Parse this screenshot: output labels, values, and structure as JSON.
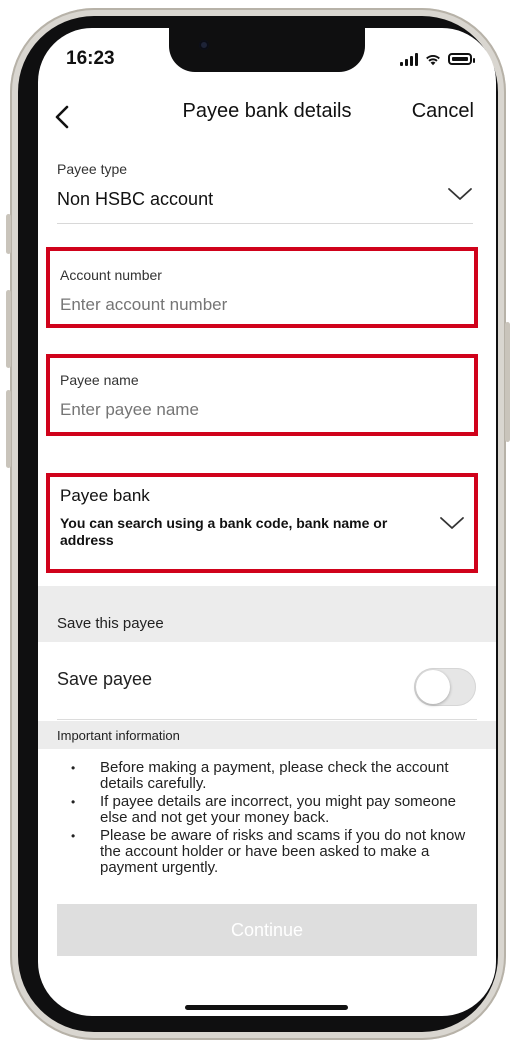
{
  "status_bar": {
    "time": "16:23",
    "signal_icon": "cellular-signal-icon",
    "wifi_icon": "wifi-icon",
    "battery_icon": "battery-icon"
  },
  "nav": {
    "back_icon": "chevron-left-icon",
    "title": "Payee bank details",
    "cancel_label": "Cancel"
  },
  "payee_type": {
    "label": "Payee type",
    "value": "Non HSBC account",
    "chevron_icon": "chevron-down-icon"
  },
  "account_number": {
    "label": "Account number",
    "placeholder": "Enter account number"
  },
  "payee_name": {
    "label": "Payee name",
    "placeholder": "Enter payee name"
  },
  "payee_bank": {
    "label": "Payee bank",
    "hint": "You can search using a bank code, bank name or address",
    "chevron_icon": "chevron-down-icon"
  },
  "save_section": {
    "title": "Save this payee",
    "toggle_label": "Save payee",
    "toggle_on": false
  },
  "important_info": {
    "title": "Important information",
    "items": [
      "Before making a payment, please check the account details carefully.",
      "If payee details are incorrect, you might pay someone else and not get your money back.",
      "Please be aware of risks and scams if you do not know the account holder or have been asked to make a payment urgently."
    ]
  },
  "footer": {
    "continue_label": "Continue"
  },
  "colors": {
    "highlight": "#d0021b",
    "section_bg": "#ececec",
    "disabled_button": "#dedede"
  }
}
